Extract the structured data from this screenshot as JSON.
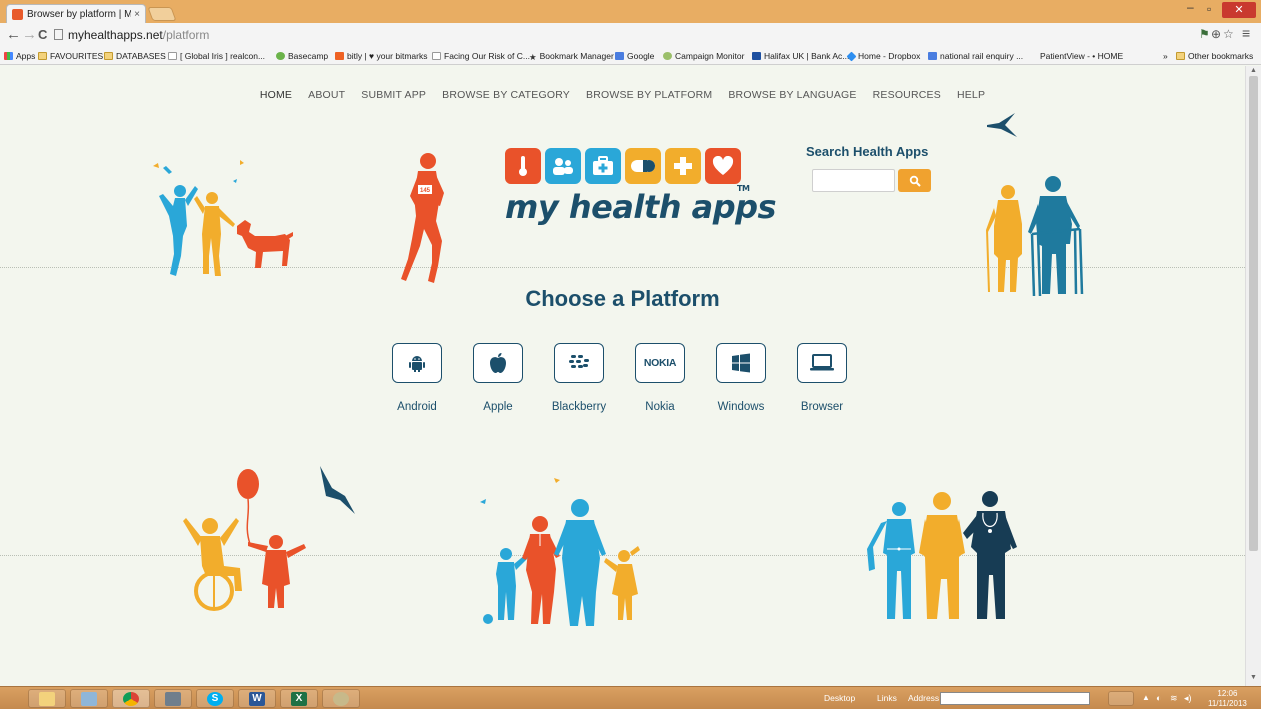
{
  "browser": {
    "tab_title": "Browser by platform | My h",
    "tab_close": "×",
    "url_host": "myhealthapps.net",
    "url_path": "/platform",
    "back": "←",
    "forward": "→",
    "reload": "C",
    "menu": "≡",
    "zoom": "⊕",
    "star": "☆",
    "bookmarks": [
      "Apps",
      "FAVOURITES",
      "DATABASES",
      "[ Global Iris ] realcon...",
      "Basecamp",
      "bitly | ♥ your bitmarks",
      "Facing Our Risk of C...",
      "Bookmark Manager",
      "Google",
      "Campaign Monitor",
      "Halifax UK | Bank Ac...",
      "Home - Dropbox",
      "national rail enquiry ...",
      "PatientView - • HOME",
      "»",
      "Other bookmarks"
    ]
  },
  "site": {
    "nav": [
      "HOME",
      "ABOUT",
      "SUBMIT APP",
      "BROWSE BY CATEGORY",
      "BROWSE BY PLATFORM",
      "BROWSE BY LANGUAGE",
      "RESOURCES",
      "HELP"
    ],
    "logo_text": "my health apps",
    "logo_tm": "TM",
    "search_title": "Search Health Apps",
    "search_value": "",
    "page_title": "Choose a Platform",
    "runner_bib": "145",
    "platforms": [
      {
        "label": "Android",
        "icon": "android-icon"
      },
      {
        "label": "Apple",
        "icon": "apple-icon"
      },
      {
        "label": "Blackberry",
        "icon": "blackberry-icon"
      },
      {
        "label": "Nokia",
        "icon": "nokia-icon",
        "badge": "NOKIA"
      },
      {
        "label": "Windows",
        "icon": "windows-icon"
      },
      {
        "label": "Browser",
        "icon": "laptop-icon"
      }
    ],
    "tiles": [
      {
        "icon": "thermometer-icon",
        "color": "#e9522a"
      },
      {
        "icon": "people-icon",
        "color": "#2aa7d8"
      },
      {
        "icon": "medical-kit-icon",
        "color": "#2aa7d8"
      },
      {
        "icon": "pill-icon",
        "color": "#f2ad2c"
      },
      {
        "icon": "cross-icon",
        "color": "#f2ad2c"
      },
      {
        "icon": "heart-icon",
        "color": "#e9522a"
      }
    ]
  },
  "taskbar": {
    "desktop": "Desktop",
    "links": "Links",
    "address": "Address",
    "time": "12:06",
    "date": "11/11/2013"
  },
  "colors": {
    "navy": "#1c4f6b",
    "orange": "#e9522a",
    "cyan": "#2aa7d8",
    "yellow": "#f2ad2c",
    "teal": "#1f7a9e"
  }
}
